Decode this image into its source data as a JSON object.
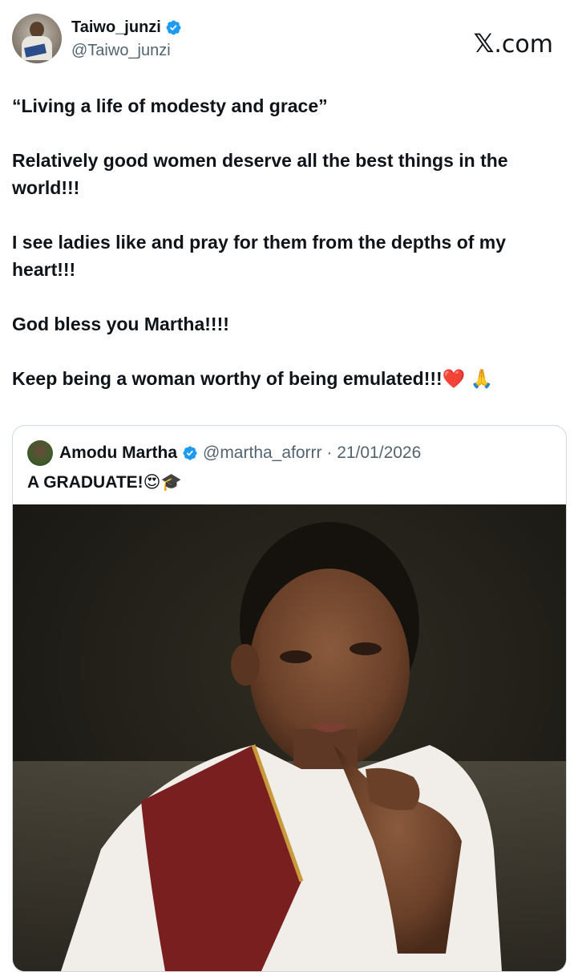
{
  "author": {
    "display_name": "Taiwo_junzi",
    "handle": "@Taiwo_junzi",
    "verified": true,
    "avatar_icon": "avatar-child-reading"
  },
  "brand": {
    "logo_mark": "𝕏",
    "logo_suffix": ".com"
  },
  "tweet": {
    "paragraphs": [
      "“Living a life of modesty and grace”",
      "Relatively good women deserve all the best things in the world!!!",
      "I see ladies like and pray for them from the depths of my heart!!!",
      "God bless you Martha!!!!",
      "Keep being a woman worthy of being emulated!!!❤️ 🙏"
    ]
  },
  "quoted": {
    "display_name": "Amodu Martha",
    "verified": true,
    "meta": "@martha_aforrr · 21/01/2026",
    "text": "A GRADUATE!😍🎓",
    "image_icon": "graduate-portrait-photo"
  },
  "colors": {
    "text": "#0f1419",
    "secondary": "#536471",
    "verified_blue": "#1d9bf0",
    "border": "#cfd9de"
  }
}
